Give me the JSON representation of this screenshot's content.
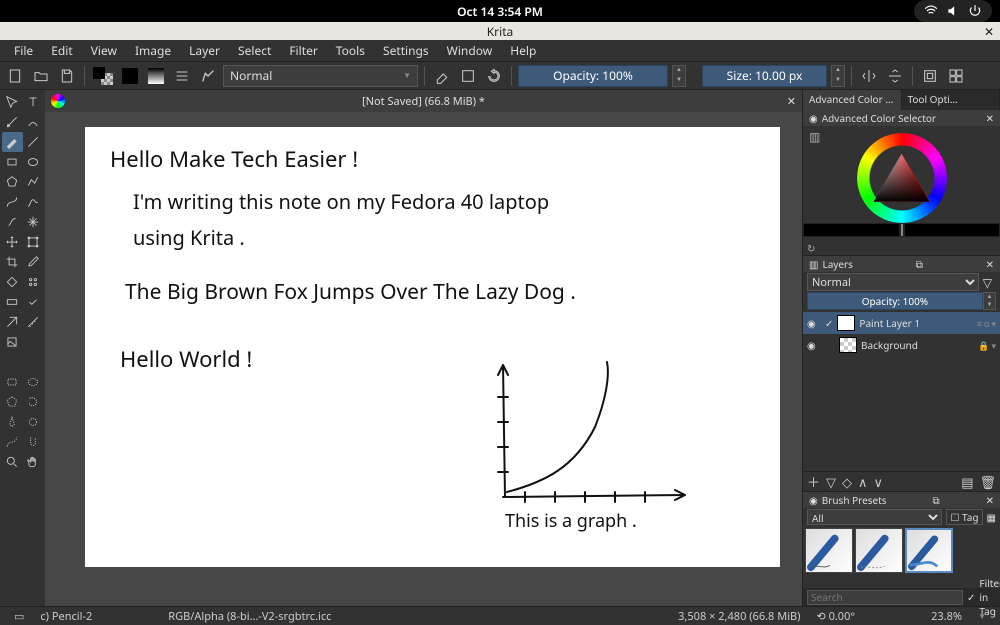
{
  "os": {
    "datetime": "Oct 14   3:54 PM"
  },
  "window": {
    "title": "Krita"
  },
  "menu": [
    "File",
    "Edit",
    "View",
    "Image",
    "Layer",
    "Select",
    "Filter",
    "Tools",
    "Settings",
    "Window",
    "Help"
  ],
  "toolbar": {
    "blend_mode": "Normal",
    "opacity": "Opacity: 100%",
    "size": "Size: 10.00 px"
  },
  "document": {
    "tab_title": "[Not Saved]  (66.8 MiB) *"
  },
  "canvas_text": {
    "line1": "Hello Make Tech Easier !",
    "line2": "I'm writing this note on my Fedora 40 laptop",
    "line3": "using Krita .",
    "line4": "The Big Brown Fox Jumps Over The Lazy Dog .",
    "line5": "Hello World !",
    "graph_caption": "This is a graph ."
  },
  "right": {
    "tab_color": "Advanced Color Selec…",
    "tab_tool": "Tool Opti…",
    "color_title": "Advanced Color Selector",
    "layers_title": "Layers",
    "layer_blend": "Normal",
    "layer_opacity": "Opacity:  100%",
    "layers": [
      {
        "name": "Paint Layer 1",
        "active": true
      },
      {
        "name": "Background",
        "active": false
      }
    ],
    "brush_title": "Brush Presets",
    "preset_filter": "All",
    "tag_label": "Tag",
    "search_placeholder": "Search",
    "filter_tag_label": "Filter in Tag"
  },
  "statusbar": {
    "brush": "c) Pencil-2",
    "colorspace": "RGB/Alpha (8-bi…-V2-srgbtrc.icc",
    "dims": "3,508 × 2,480 (66.8 MiB)",
    "angle": "0.00°",
    "zoom": "23.8%"
  }
}
